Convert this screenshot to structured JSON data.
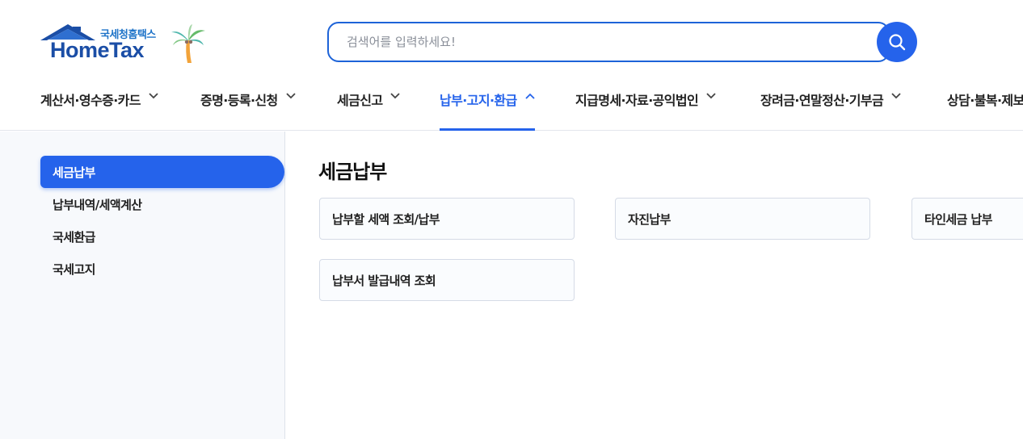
{
  "logo": {
    "subtitle": "국세청홈택스",
    "title": "HomeTax"
  },
  "search": {
    "placeholder": "검색어를 입력하세요!",
    "value": ""
  },
  "gnb": {
    "items": [
      {
        "label": "계산서·영수증·카드",
        "state": "collapsed"
      },
      {
        "label": "증명·등록·신청",
        "state": "collapsed"
      },
      {
        "label": "세금신고",
        "state": "collapsed"
      },
      {
        "label": "납부·고지·환급",
        "state": "expanded"
      },
      {
        "label": "지급명세·자료·공익법인",
        "state": "collapsed"
      },
      {
        "label": "장려금·연말정산·기부금",
        "state": "collapsed"
      },
      {
        "label": "상담·불복·제보",
        "state": "collapsed"
      }
    ]
  },
  "sidebar": {
    "items": [
      {
        "label": "세금납부"
      },
      {
        "label": "납부내역/세액계산"
      },
      {
        "label": "국세환급"
      },
      {
        "label": "국세고지"
      }
    ]
  },
  "main": {
    "title": "세금납부",
    "cards": [
      {
        "label": "납부할 세액 조회/납부"
      },
      {
        "label": "자진납부"
      },
      {
        "label": "타인세금 납부"
      },
      {
        "label": "납부서 발급내역 조회"
      }
    ]
  },
  "colors": {
    "accent": "#2563eb",
    "logo_blue": "#1b4ea6",
    "sidebar_bg": "#f7f9fc"
  }
}
